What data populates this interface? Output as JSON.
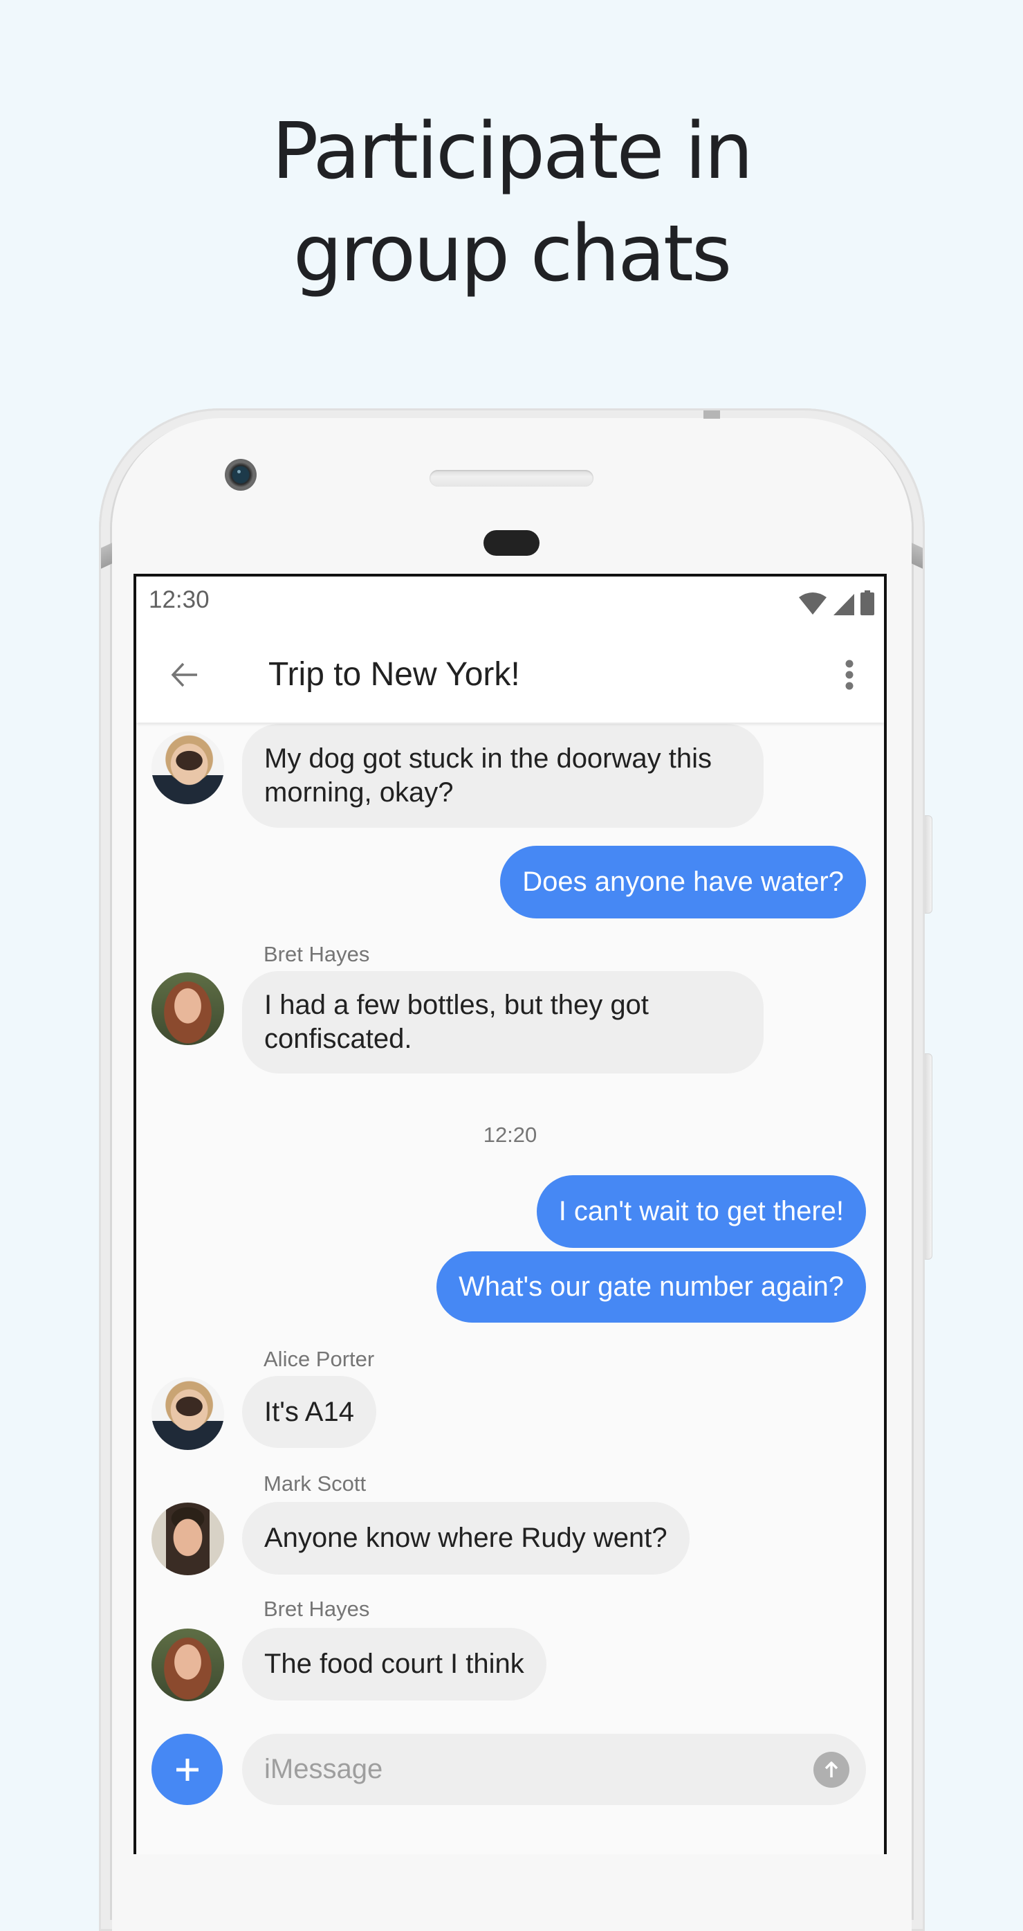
{
  "headline": {
    "line1": "Participate in",
    "line2": "group chats"
  },
  "status_bar": {
    "time": "12:30",
    "icons": [
      "wifi-icon",
      "cellular-signal-icon",
      "battery-icon"
    ]
  },
  "app_bar": {
    "back_icon": "arrow-back-icon",
    "title": "Trip to New York!",
    "menu_icon": "more-vert-icon"
  },
  "colors": {
    "page_background": "#F0F8FC",
    "outgoing_bubble": "#4688F4",
    "incoming_bubble": "#EEEEEE",
    "chat_background": "#FAFAFA",
    "accent": "#4688F4"
  },
  "messages": [
    {
      "direction": "incoming",
      "sender": "Alice Porter",
      "show_sender": false,
      "text": "My dog got stuck in the doorway this morning, okay?"
    },
    {
      "direction": "outgoing",
      "text": "Does anyone have water?"
    },
    {
      "direction": "incoming",
      "sender": "Bret Hayes",
      "show_sender": true,
      "text": "I had a few bottles, but they got confiscated."
    },
    {
      "type": "timestamp",
      "text": "12:20"
    },
    {
      "direction": "outgoing",
      "text": "I can't wait to get there!"
    },
    {
      "direction": "outgoing",
      "text": "What's our gate number again?"
    },
    {
      "direction": "incoming",
      "sender": "Alice Porter",
      "show_sender": true,
      "text": "It's A14"
    },
    {
      "direction": "incoming",
      "sender": "Mark Scott",
      "show_sender": true,
      "text": "Anyone know where Rudy went?"
    },
    {
      "direction": "incoming",
      "sender": "Bret Hayes",
      "show_sender": true,
      "text": "The food court I think"
    }
  ],
  "composer": {
    "add_icon": "plus-icon",
    "placeholder": "iMessage",
    "value": "",
    "send_icon": "arrow-up-send-icon"
  }
}
